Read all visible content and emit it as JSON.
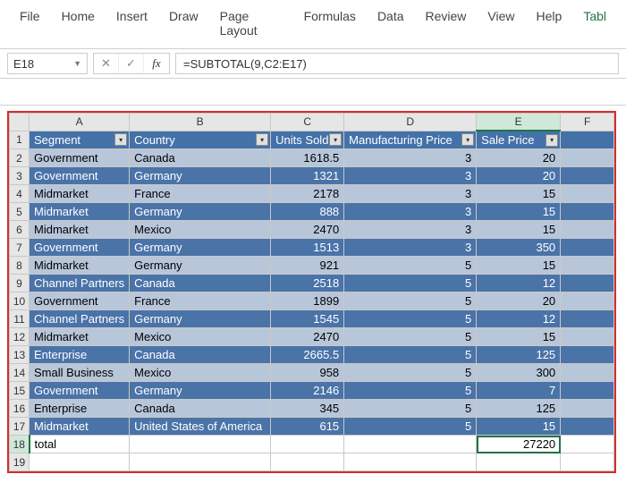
{
  "ribbon": {
    "tabs": [
      "File",
      "Home",
      "Insert",
      "Draw",
      "Page Layout",
      "Formulas",
      "Data",
      "Review",
      "View",
      "Help",
      "Tabl"
    ],
    "active": 10
  },
  "formulaBar": {
    "nameBox": "E18",
    "formula": "=SUBTOTAL(9,C2:E17)"
  },
  "columns": [
    "A",
    "B",
    "C",
    "D",
    "E",
    "F"
  ],
  "headers": {
    "segment": "Segment",
    "country": "Country",
    "units": "Units Sold",
    "mfg": "Manufacturing Price",
    "sale": "Sale Price"
  },
  "rows": [
    {
      "n": 2,
      "seg": "Government",
      "cty": "Canada",
      "u": "1618.5",
      "m": "3",
      "s": "20"
    },
    {
      "n": 3,
      "seg": "Government",
      "cty": "Germany",
      "u": "1321",
      "m": "3",
      "s": "20"
    },
    {
      "n": 4,
      "seg": "Midmarket",
      "cty": "France",
      "u": "2178",
      "m": "3",
      "s": "15"
    },
    {
      "n": 5,
      "seg": "Midmarket",
      "cty": "Germany",
      "u": "888",
      "m": "3",
      "s": "15"
    },
    {
      "n": 6,
      "seg": "Midmarket",
      "cty": "Mexico",
      "u": "2470",
      "m": "3",
      "s": "15"
    },
    {
      "n": 7,
      "seg": "Government",
      "cty": "Germany",
      "u": "1513",
      "m": "3",
      "s": "350"
    },
    {
      "n": 8,
      "seg": "Midmarket",
      "cty": "Germany",
      "u": "921",
      "m": "5",
      "s": "15"
    },
    {
      "n": 9,
      "seg": "Channel Partners",
      "cty": "Canada",
      "u": "2518",
      "m": "5",
      "s": "12"
    },
    {
      "n": 10,
      "seg": "Government",
      "cty": "France",
      "u": "1899",
      "m": "5",
      "s": "20"
    },
    {
      "n": 11,
      "seg": "Channel Partners",
      "cty": "Germany",
      "u": "1545",
      "m": "5",
      "s": "12"
    },
    {
      "n": 12,
      "seg": "Midmarket",
      "cty": "Mexico",
      "u": "2470",
      "m": "5",
      "s": "15"
    },
    {
      "n": 13,
      "seg": "Enterprise",
      "cty": "Canada",
      "u": "2665.5",
      "m": "5",
      "s": "125"
    },
    {
      "n": 14,
      "seg": "Small Business",
      "cty": "Mexico",
      "u": "958",
      "m": "5",
      "s": "300"
    },
    {
      "n": 15,
      "seg": "Government",
      "cty": "Germany",
      "u": "2146",
      "m": "5",
      "s": "7"
    },
    {
      "n": 16,
      "seg": "Enterprise",
      "cty": "Canada",
      "u": "345",
      "m": "5",
      "s": "125"
    },
    {
      "n": 17,
      "seg": "Midmarket",
      "cty": "United States of America",
      "u": "615",
      "m": "5",
      "s": "15"
    }
  ],
  "total": {
    "n": 18,
    "label": "total",
    "value": "27220"
  },
  "lastRow": 19
}
